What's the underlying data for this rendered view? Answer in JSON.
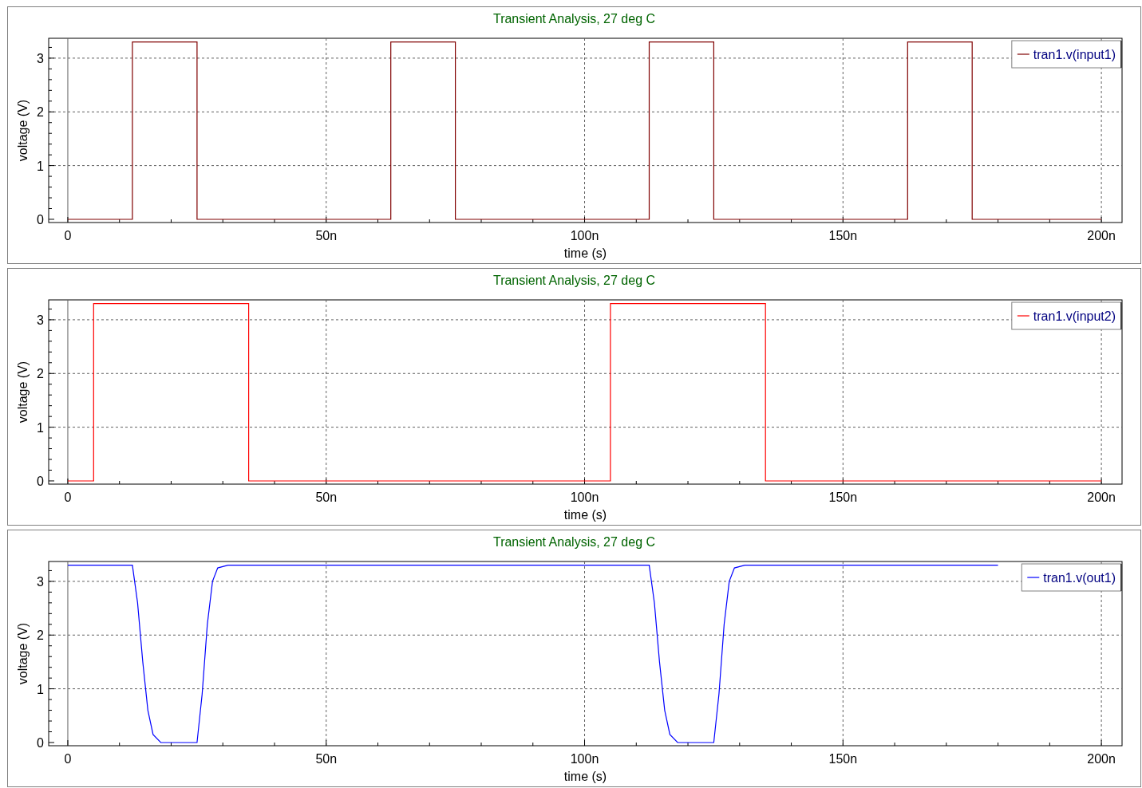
{
  "panels": [
    {
      "title": "Transient Analysis, 27 deg C",
      "chart_data": {
        "type": "line",
        "grid": true,
        "xlabel": "time (s)",
        "ylabel": "voltage (V)",
        "xlim": [
          -3.7,
          204
        ],
        "ylim": [
          -0.06,
          3.37
        ],
        "xticks": [
          {
            "value": 0,
            "label": "0"
          },
          {
            "value": 50,
            "label": "50n"
          },
          {
            "value": 100,
            "label": "100n"
          },
          {
            "value": 150,
            "label": "150n"
          },
          {
            "value": 200,
            "label": "200n"
          }
        ],
        "yticks": [
          0,
          1,
          2,
          3
        ],
        "x": [
          0,
          12.5,
          12.5,
          25,
          25,
          62.5,
          62.5,
          75,
          75,
          112.5,
          112.5,
          125,
          125,
          162.5,
          162.5,
          175,
          175,
          200
        ],
        "series": [
          {
            "name": "tran1.v(input1)",
            "color": "#800000",
            "values": [
              0,
              0,
              3.3,
              3.3,
              0,
              0,
              3.3,
              3.3,
              0,
              0,
              3.3,
              3.3,
              0,
              0,
              3.3,
              3.3,
              0,
              0
            ]
          }
        ]
      }
    },
    {
      "title": "Transient Analysis, 27 deg C",
      "chart_data": {
        "type": "line",
        "grid": true,
        "xlabel": "time (s)",
        "ylabel": "voltage (V)",
        "xlim": [
          -3.7,
          204
        ],
        "ylim": [
          -0.06,
          3.37
        ],
        "xticks": [
          {
            "value": 0,
            "label": "0"
          },
          {
            "value": 50,
            "label": "50n"
          },
          {
            "value": 100,
            "label": "100n"
          },
          {
            "value": 150,
            "label": "150n"
          },
          {
            "value": 200,
            "label": "200n"
          }
        ],
        "yticks": [
          0,
          1,
          2,
          3
        ],
        "x": [
          0,
          5,
          5,
          35,
          35,
          105,
          105,
          135,
          135,
          200
        ],
        "series": [
          {
            "name": "tran1.v(input2)",
            "color": "#ff0000",
            "values": [
              0,
              0,
              3.3,
              3.3,
              0,
              0,
              3.3,
              3.3,
              0,
              0
            ]
          }
        ]
      }
    },
    {
      "title": "Transient Analysis, 27 deg C",
      "chart_data": {
        "type": "line",
        "grid": true,
        "xlabel": "time (s)",
        "ylabel": "voltage (V)",
        "xlim": [
          -3.7,
          204
        ],
        "ylim": [
          -0.06,
          3.37
        ],
        "xticks": [
          {
            "value": 0,
            "label": "0"
          },
          {
            "value": 50,
            "label": "50n"
          },
          {
            "value": 100,
            "label": "100n"
          },
          {
            "value": 150,
            "label": "150n"
          },
          {
            "value": 200,
            "label": "200n"
          }
        ],
        "yticks": [
          0,
          1,
          2,
          3
        ],
        "x": [
          0,
          12.5,
          13.5,
          14.5,
          15.5,
          16.5,
          18,
          25,
          26,
          27,
          28,
          29,
          31,
          112.5,
          113.5,
          114.5,
          115.5,
          116.5,
          118,
          125,
          126,
          127,
          128,
          129,
          131,
          180
        ],
        "series": [
          {
            "name": "tran1.v(out1)",
            "color": "#0000ff",
            "values": [
              3.3,
              3.3,
              2.6,
              1.5,
              0.6,
              0.15,
              0,
              0,
              0.9,
              2.2,
              3.0,
              3.25,
              3.3,
              3.3,
              2.6,
              1.5,
              0.6,
              0.15,
              0,
              0,
              0.9,
              2.2,
              3.0,
              3.25,
              3.3,
              3.3
            ]
          }
        ]
      }
    }
  ]
}
